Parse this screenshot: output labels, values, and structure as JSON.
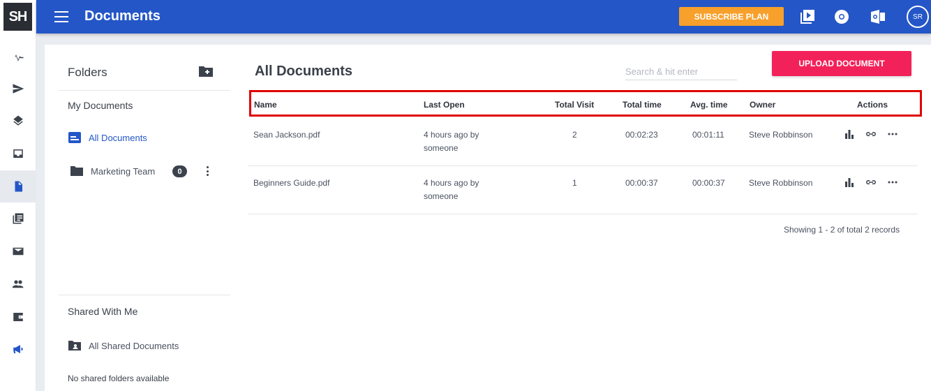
{
  "app": {
    "logo": "SH",
    "title": "Documents"
  },
  "topbar": {
    "subscribe_label": "SUBSCRIBE PLAN",
    "icons": [
      "video-icon",
      "chrome-icon",
      "outlook-icon"
    ],
    "avatar_initials": "SR"
  },
  "rail": {
    "items": [
      "activity-icon",
      "send-icon",
      "layers-icon",
      "inbox-icon",
      "document-icon",
      "library-icon",
      "mail-icon",
      "people-icon",
      "wallet-icon",
      "megaphone-icon"
    ],
    "active": "document-icon"
  },
  "folders": {
    "title": "Folders",
    "my_documents": "My Documents",
    "all_documents": "All Documents",
    "items": [
      {
        "label": "Marketing Team",
        "count": "0"
      }
    ],
    "shared_title": "Shared With Me",
    "all_shared": "All Shared Documents",
    "no_shared": "No shared folders available"
  },
  "main": {
    "title": "All Documents",
    "search_placeholder": "Search & hit enter",
    "upload_label": "UPLOAD DOCUMENT",
    "columns": [
      "Name",
      "Last Open",
      "Total Visit",
      "Total time",
      "Avg. time",
      "Owner",
      "Actions"
    ],
    "rows": [
      {
        "name": "Sean Jackson.pdf",
        "last_open_1": "4 hours ago by",
        "last_open_2": "someone",
        "visits": "2",
        "total_time": "00:02:23",
        "avg_time": "00:01:11",
        "owner": "Steve Robbinson"
      },
      {
        "name": "Beginners Guide.pdf",
        "last_open_1": "4 hours ago by",
        "last_open_2": "someone",
        "visits": "1",
        "total_time": "00:00:37",
        "avg_time": "00:00:37",
        "owner": "Steve Robbinson"
      }
    ],
    "footer": "Showing 1 - 2 of total 2 records"
  },
  "colors": {
    "brand": "#2456c7",
    "subscribe": "#f7a02b",
    "upload": "#f3215a",
    "highlight": "#e00000"
  }
}
